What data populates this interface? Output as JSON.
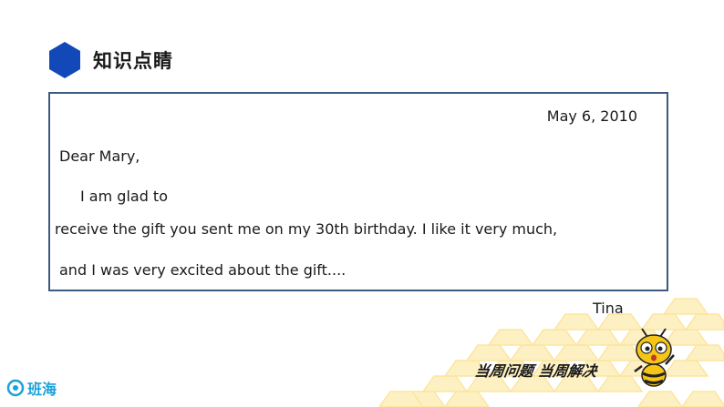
{
  "header": {
    "title": "知识点睛",
    "icon": "hexagon-icon",
    "accent_color": "#1248b8"
  },
  "letter": {
    "date": "May 6, 2010",
    "salutation": "Dear Mary,",
    "body_line_1": "I am glad to",
    "body_line_2": "receive the gift you sent me on my 30th birthday. I like it very much,",
    "body_line_3": "and I was very excited about the gift....",
    "signature": "Tina",
    "border_color": "#3d5a80"
  },
  "footer": {
    "slogan": "当周问题 当周解决",
    "brand_name": "班海",
    "brand_color": "#1aa2d9",
    "mascot": "bee-mascot-icon",
    "honeycomb_color": "#fbe8a6"
  }
}
